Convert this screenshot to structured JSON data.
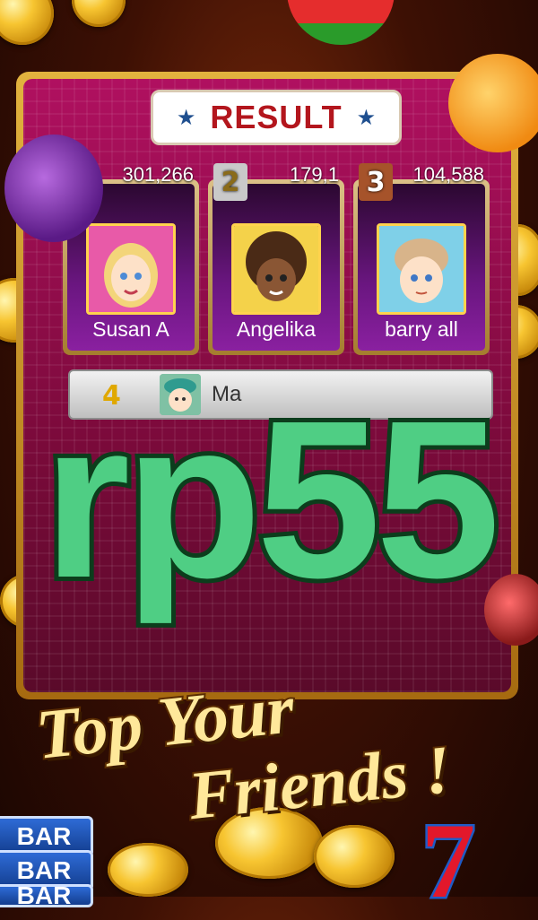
{
  "result_title": "RESULT",
  "leaderboard": [
    {
      "rank": "",
      "score": "301,266",
      "name": "Susan A",
      "badge_color": "#c9c9c9"
    },
    {
      "rank": "2",
      "score": "179,1",
      "name": "Angelika",
      "badge_color": "#c9c9c9"
    },
    {
      "rank": "3",
      "score": "104,588",
      "name": "barry all",
      "badge_color": "#a6532a"
    }
  ],
  "fourth_row": {
    "rank": "4",
    "name": "Ma"
  },
  "watermark": "rp55",
  "tagline": {
    "line1": "Top Your",
    "line2": "Friends !"
  },
  "symbols": {
    "bar": "BAR",
    "seven": "7"
  }
}
